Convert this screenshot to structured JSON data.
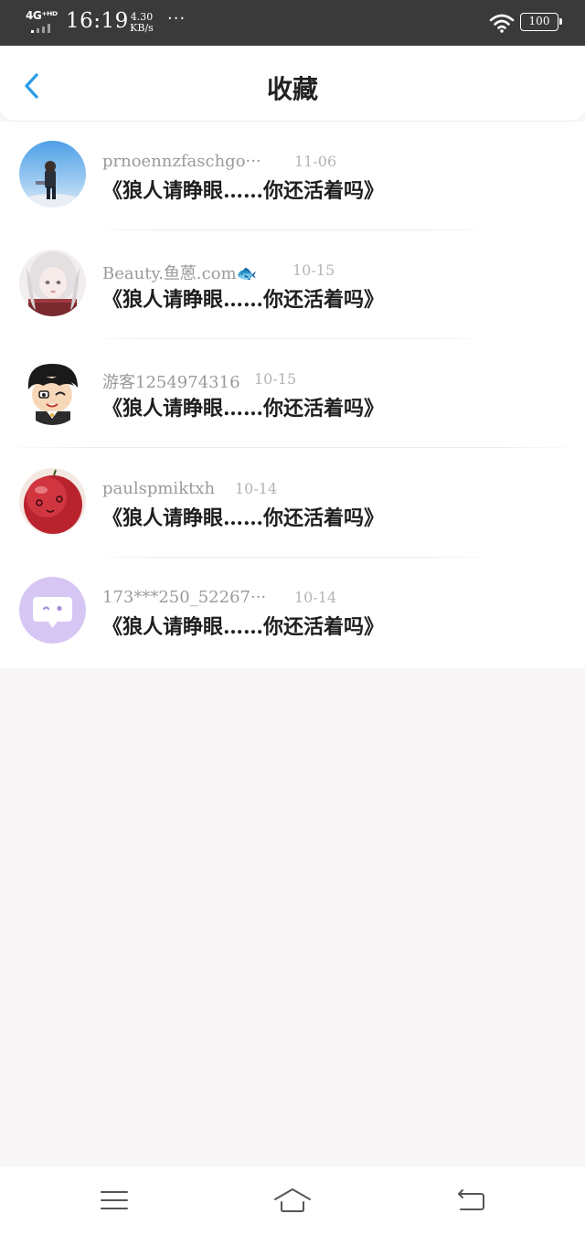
{
  "status_bar": {
    "network": "4G⁺ᴴᴰ",
    "time": "16:19",
    "speed_value": "4.30",
    "speed_unit": "KB/s",
    "more": "···",
    "battery": "100",
    "icons": [
      "signal-icon",
      "wifi-icon",
      "battery-icon"
    ]
  },
  "header": {
    "back_icon": "chevron-left-icon",
    "title": "收藏"
  },
  "favorites": [
    {
      "author": "prnoennzfaschgo···",
      "date": "11-06",
      "title": "《狼人请睁眼……你还活着吗》",
      "avatar": "avatar-photo-sky"
    },
    {
      "author": "Beauty.鱼蒽.com🐟",
      "date": "10-15",
      "title": "《狼人请睁眼……你还活着吗》",
      "avatar": "avatar-white-hair-girl"
    },
    {
      "author": "游客1254974316",
      "date": "10-15",
      "title": "《狼人请睁眼……你还活着吗》",
      "avatar": "avatar-cartoon-boy"
    },
    {
      "author": "paulspmiktxh",
      "date": "10-14",
      "title": "《狼人请睁眼……你还活着吗》",
      "avatar": "avatar-red-fruit"
    },
    {
      "author": "173***250_52267···",
      "date": "10-14",
      "title": "《狼人请睁眼……你还活着吗》",
      "avatar": "avatar-default-chat"
    }
  ],
  "nav_bar": {
    "icons": [
      "menu-icon",
      "home-icon",
      "back-icon"
    ]
  },
  "colors": {
    "status_bar_bg": "#3a3a3a",
    "accent": "#2a9be8",
    "page_bg": "#f8f6f7",
    "author_text": "#9a9a9a",
    "date_text": "#b4b4b4"
  }
}
